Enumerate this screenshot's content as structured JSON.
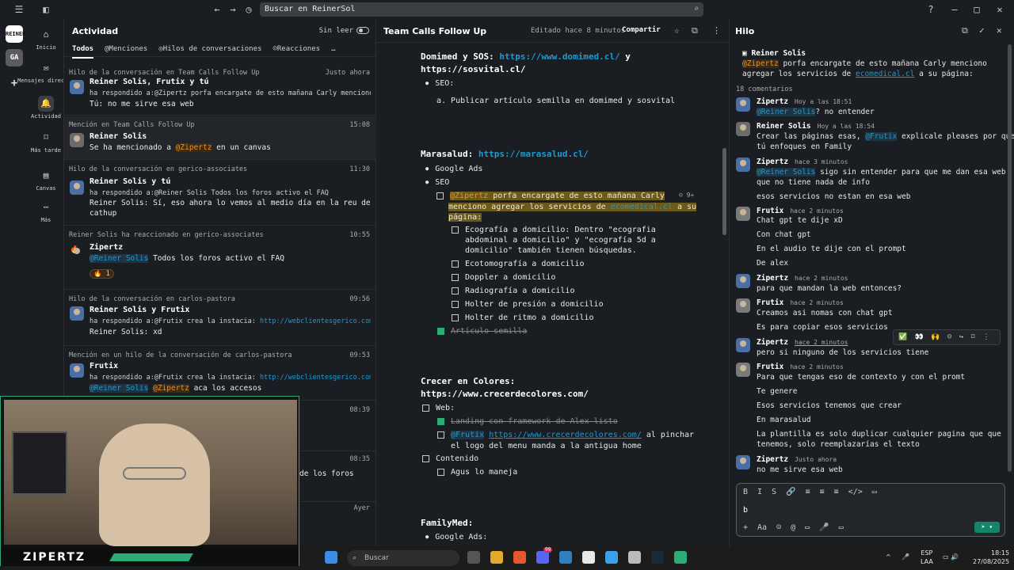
{
  "titlebar": {
    "search": "Buscar en ReinerSol"
  },
  "rail": {
    "workspace_abbr": "REINER",
    "workspace2": "GA"
  },
  "nav": [
    {
      "label": "Inicio"
    },
    {
      "label": "Mensajes directos"
    },
    {
      "label": "Actividad"
    },
    {
      "label": "Más tarde"
    },
    {
      "label": "Canvas"
    },
    {
      "label": "Más"
    }
  ],
  "activity": {
    "title": "Actividad",
    "unread_label": "Sin leer",
    "tabs": [
      "Todos",
      "Menciones",
      "Hilos de conversaciones",
      "Reacciones",
      "…"
    ],
    "items": [
      {
        "meta": "Hilo de la conversación en Team Calls Follow Up",
        "time": "Justo ahora",
        "name": "Reiner Solis, Frutix y tú",
        "sub": "ha respondido a:@Zipertz porfa encargate de esto mañana Carly menciono ag…",
        "text": "Tú: no me sirve esa web"
      },
      {
        "meta": "Mención en Team Calls Follow Up",
        "time": "15:08",
        "name": "Reiner Solis",
        "text1": "Se ha mencionado a ",
        "mention": "@Zipertz",
        "text2": " en un canvas"
      },
      {
        "meta": "Hilo de la conversación en gerico-associates",
        "time": "11:30",
        "name": "Reiner Solis y tú",
        "sub": "ha respondido a:@Reiner Solis Todos los foros activo el FAQ",
        "text": "Reiner Solis: Sí, eso ahora lo vemos al medio día en la reu de",
        "text_b": "cathup"
      },
      {
        "meta": "Reiner Solis ha reaccionado en gerico-associates",
        "time": "10:55",
        "name": "Zipertz",
        "mention": "@Reiner Solis",
        "text": " Todos los foros activo el FAQ",
        "reaction": "🔥 1"
      },
      {
        "meta": "Hilo de la conversación en carlos-pastora",
        "time": "09:56",
        "name": "Reiner Solis y Frutix",
        "sub1": "ha respondido a:@Frutix crea la instacia: ",
        "sub_link": "http://webclientesgerico.com/c…",
        "text": "Reiner Solis: xd"
      },
      {
        "meta": "Mención en un hilo de la conversación de carlos-pastora",
        "time": "09:53",
        "name": "Frutix",
        "sub1": "ha respondido a:@Frutix crea la instacia: ",
        "sub_link": "http://webclientesgerico.com/c…",
        "m1": "@Reiner Solis",
        "m2": "@Zipertz",
        "text": " aca los accesos"
      },
      {
        "time": "08:39"
      },
      {
        "time": "08:35",
        "text": "de los foros"
      },
      {
        "time": "Ayer"
      }
    ]
  },
  "canvas": {
    "title": "Team Calls Follow Up",
    "edited": "Editado hace 8 minutos",
    "share": "Compartir",
    "lines": {
      "l1a": "Domimed y SOS: ",
      "l1b": "https://www.domimed.cl/",
      "l1c": " y",
      "l2": "https://sosvital.cl/",
      "seo": "SEO:",
      "a": "a. Publicar artículo semilla en domimed y sosvital",
      "mara": "Marasalud: ",
      "mara_link": "https://marasalud.cl/",
      "gads": "Google Ads",
      "seo2": "SEO",
      "task_m": "@Zipertz",
      "task1": " porfa encargate de esto mañana Carly",
      "task2": "menciono agregar los servicios de ",
      "task2_link": "ecomedical.cl",
      "task2b": " a su",
      "task3": "página:",
      "comments": "9+",
      "e1": "Ecografía a domicilio: Dentro \"ecografia",
      "e1b": "abdominal a domicilio\" y \"ecografía 5d a",
      "e1c": "domicilio\" también tienen búsquedas.",
      "e2": "Ecotomografía a domicilio",
      "e3": "Doppler a domicilio",
      "e4": "Radiografía a domicilio",
      "e5": "Holter de presión a domicilio",
      "e6": "Holter de ritmo a domicilio",
      "e7": "Artículo semilla",
      "crecer": "Crecer en Colores:",
      "crecer_link": "https://www.crecerdecolores.com/",
      "web": "Web:",
      "landing": "Landing con framework de Alex listo",
      "fr": "@Frutix",
      "fr_link": "https://www.crecerdecolores.com/",
      "fr_t": " al pinchar",
      "fr_t2": "el logo del menu manda a la antigua home",
      "cont": "Contenido",
      "agus": "Agus lo maneja",
      "family": "FamilyMed:",
      "gads2": "Google Ads:"
    }
  },
  "thread": {
    "title": "Hilo",
    "root_name": "Reiner Solis",
    "root_m": "@Zipertz",
    "root_t": " porfa encargate de esto mañana Carly menciono",
    "root_t2": "agregar los servicios de ",
    "root_link": "ecomedical.cl",
    "root_t3": " a su página:",
    "count": "18 comentarios",
    "msgs": [
      {
        "name": "Zipertz",
        "time": "Hoy a las 18:51",
        "m": "@Reiner Solis",
        "lines": [
          "? no entender"
        ]
      },
      {
        "name": "Reiner Solis",
        "time": "Hoy a las 18:54",
        "lines": [
          "Crear las páginas esas, ",
          "tú enfoques en Family"
        ],
        "m": "@Frutix",
        "after": " explicale pleases por que"
      },
      {
        "name": "Zipertz",
        "time": "hace 3 minutos",
        "m": "@Reiner Solis",
        "lines": [
          " sigo sin entender para que me dan esa web",
          "que no tiene nada de info",
          "esos servicios no estan en esa web"
        ]
      },
      {
        "name": "Frutix",
        "time": "hace 2 minutos",
        "lines": [
          "Chat gpt te dije xD",
          "Con chat gpt",
          "En el audio te dije con el prompt",
          "De alex"
        ]
      },
      {
        "name": "Zipertz",
        "time": "hace 2 minutos",
        "lines": [
          "para que mandan la web entonces?"
        ]
      },
      {
        "name": "Frutix",
        "time": "hace 2 minutos",
        "lines": [
          "Creamos asi nomas con chat gpt",
          "Es para copiar esos servicios"
        ]
      },
      {
        "name": "Zipertz",
        "time": "hace 2 minutos",
        "lines": [
          "pero si ninguno de los servicios tiene"
        ]
      },
      {
        "name": "Frutix",
        "time": "hace 2 minutos",
        "lines": [
          "Para que tengas eso de contexto y con el promt",
          "Te genere",
          "Esos servicios tenemos que crear",
          "En marasalud",
          "La plantilla es solo duplicar cualquier pagina que que",
          "tenemos, solo reemplazarías el texto"
        ]
      },
      {
        "name": "Zipertz",
        "time": "Justo ahora",
        "lines": [
          "no me sirve esa web"
        ]
      }
    ],
    "compose_text": "b",
    "toolbar": "B I S 🔗 ≡ ≡ ≡ </> ▭",
    "toolbar2": "+ Aa ☺ @ ▭ 🎤 ▭"
  },
  "video": {
    "brand": "ZIPERTZ"
  },
  "taskbar": {
    "search": "Buscar",
    "lang1": "ESP",
    "lang2": "LAA",
    "time": "18:15",
    "date": "27/08/2025",
    "badge": "99"
  },
  "colors": {
    "accent": "#1d9bd1",
    "green": "#2bac76",
    "mention": "#e8912d"
  }
}
